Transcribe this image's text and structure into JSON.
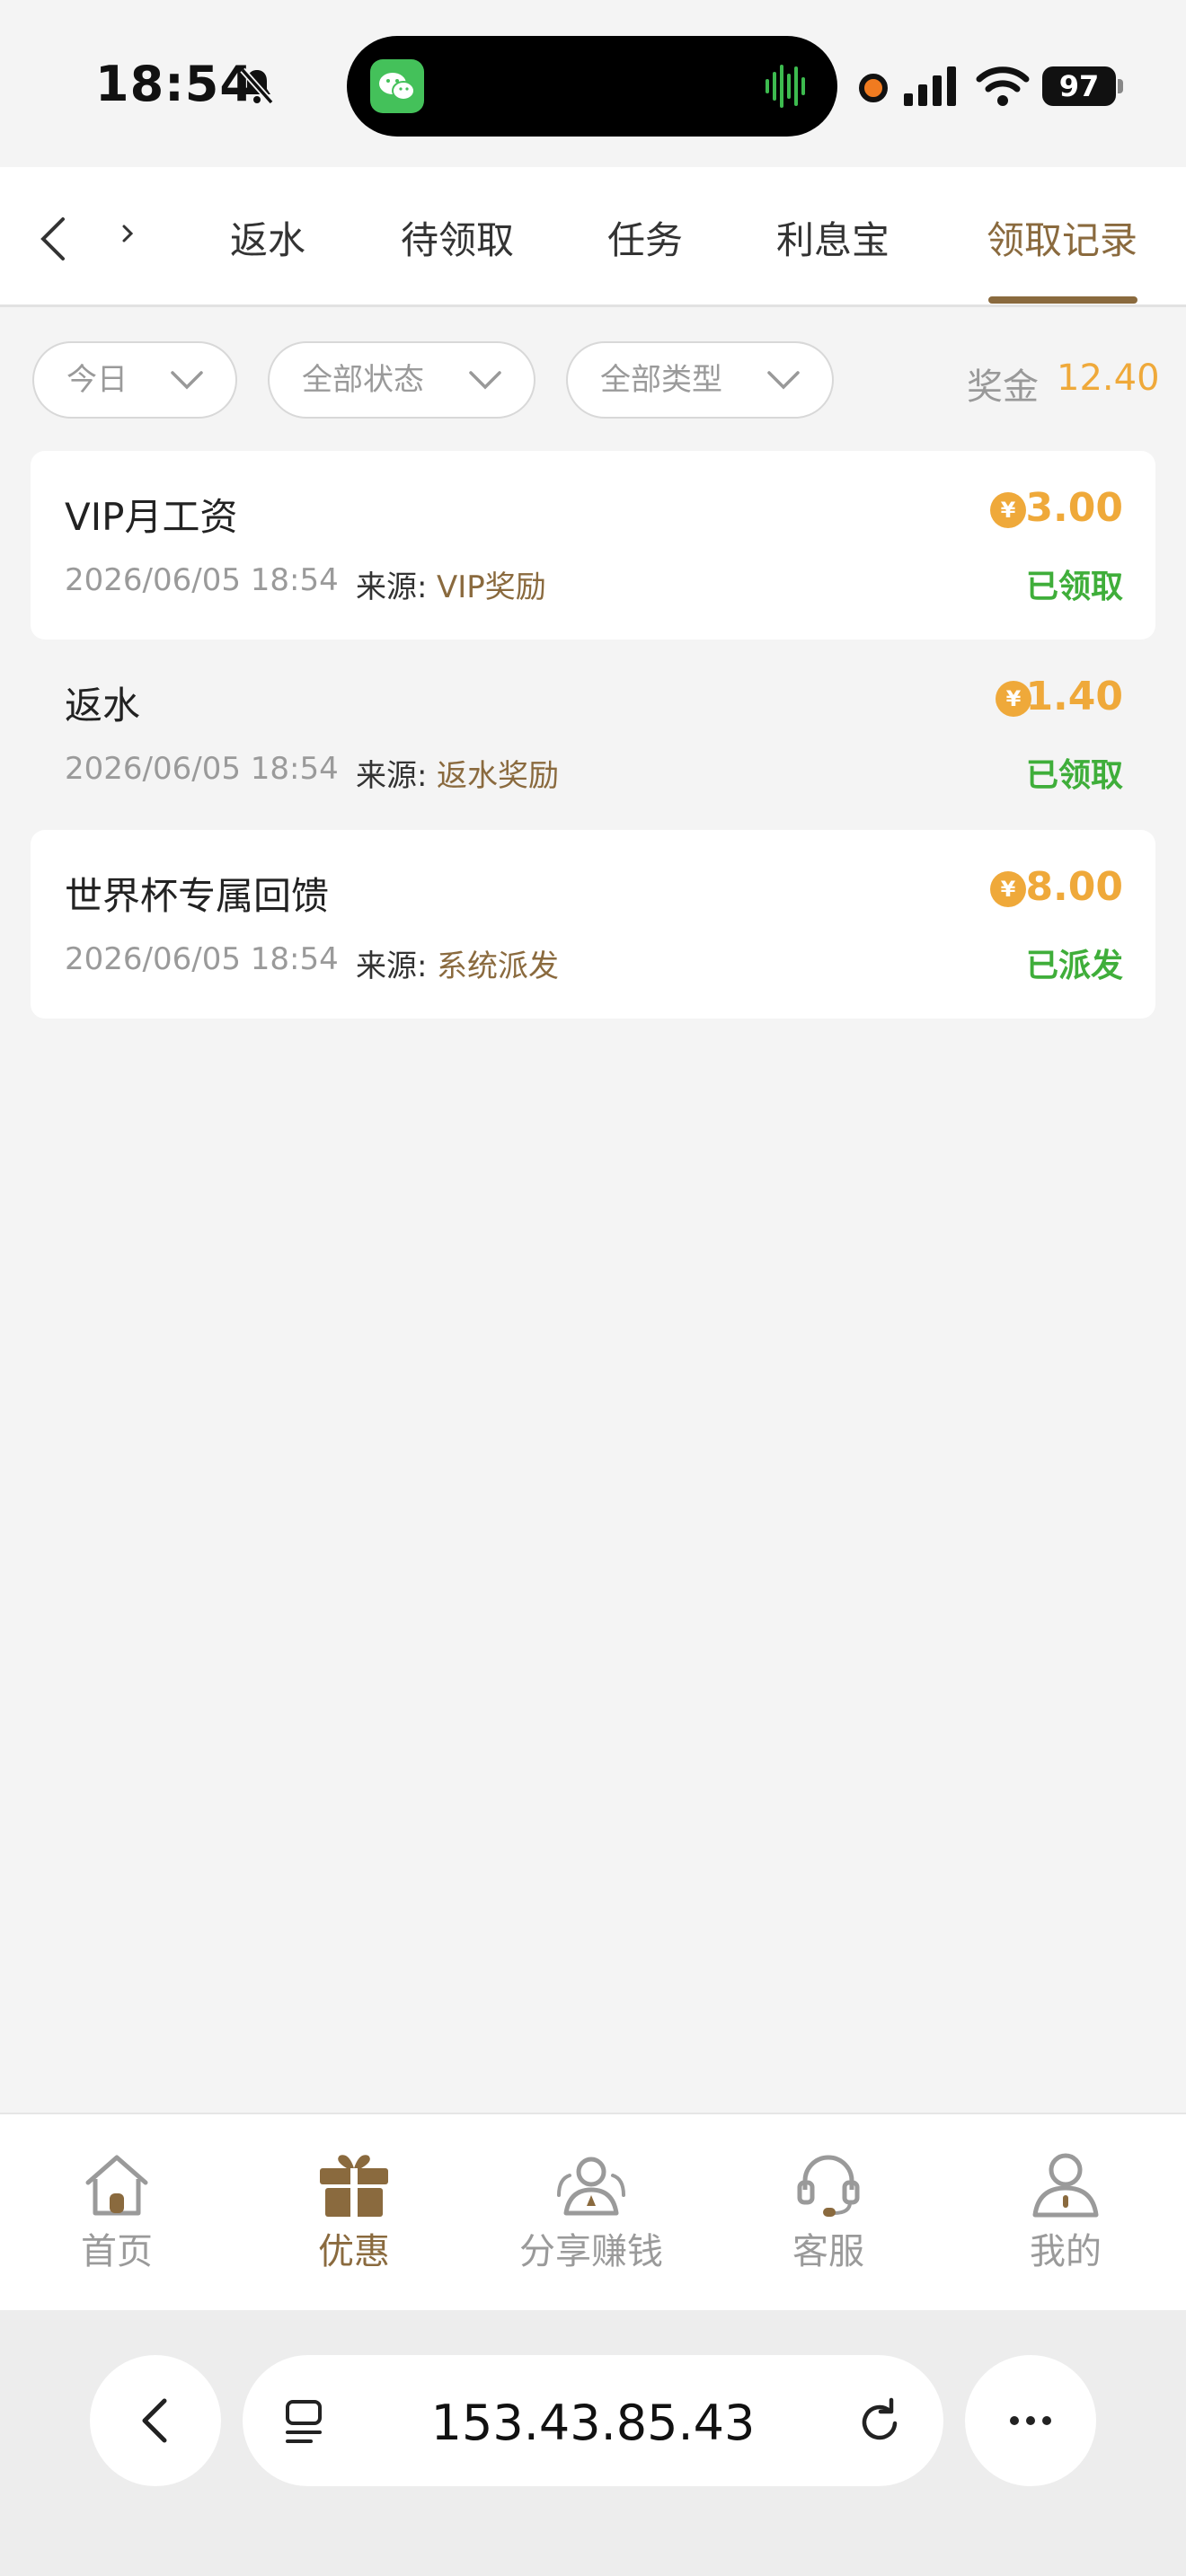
{
  "status_bar": {
    "time": "18:54",
    "battery": "97",
    "icons": [
      "bell-slash-icon",
      "wechat-icon",
      "voice-wave-icon",
      "recording-dot-icon",
      "signal-icon",
      "wifi-icon",
      "battery-icon"
    ]
  },
  "tabs": {
    "items": [
      {
        "label": "返水"
      },
      {
        "label": "待领取"
      },
      {
        "label": "任务"
      },
      {
        "label": "利息宝"
      },
      {
        "label": "领取记录",
        "active": true
      }
    ],
    "accent_color": "#8a6a3e"
  },
  "filters": {
    "date": "今日",
    "status": "全部状态",
    "type": "全部类型"
  },
  "bonus": {
    "label": "奖金",
    "value": "12.40",
    "color": "#efa93a"
  },
  "source_label": "来源:",
  "coin_symbol": "¥",
  "records": [
    {
      "title": "VIP月工资",
      "date": "2026/06/05 18:54",
      "source": "VIP奖励",
      "amount": "3.00",
      "status": "已领取"
    },
    {
      "title": "返水",
      "date": "2026/06/05 18:54",
      "source": "返水奖励",
      "amount": "1.40",
      "status": "已领取"
    },
    {
      "title": "世界杯专属回馈",
      "date": "2026/06/05 18:54",
      "source": "系统派发",
      "amount": "8.00",
      "status": "已派发"
    }
  ],
  "status_color": "#3fae3a",
  "bottom_nav": {
    "items": [
      {
        "label": "首页",
        "icon": "home-icon"
      },
      {
        "label": "优惠",
        "icon": "gift-icon",
        "active": true
      },
      {
        "label": "分享赚钱",
        "icon": "share-people-icon"
      },
      {
        "label": "客服",
        "icon": "headset-icon"
      },
      {
        "label": "我的",
        "icon": "user-icon"
      }
    ]
  },
  "browser": {
    "url": "153.43.85.43"
  }
}
